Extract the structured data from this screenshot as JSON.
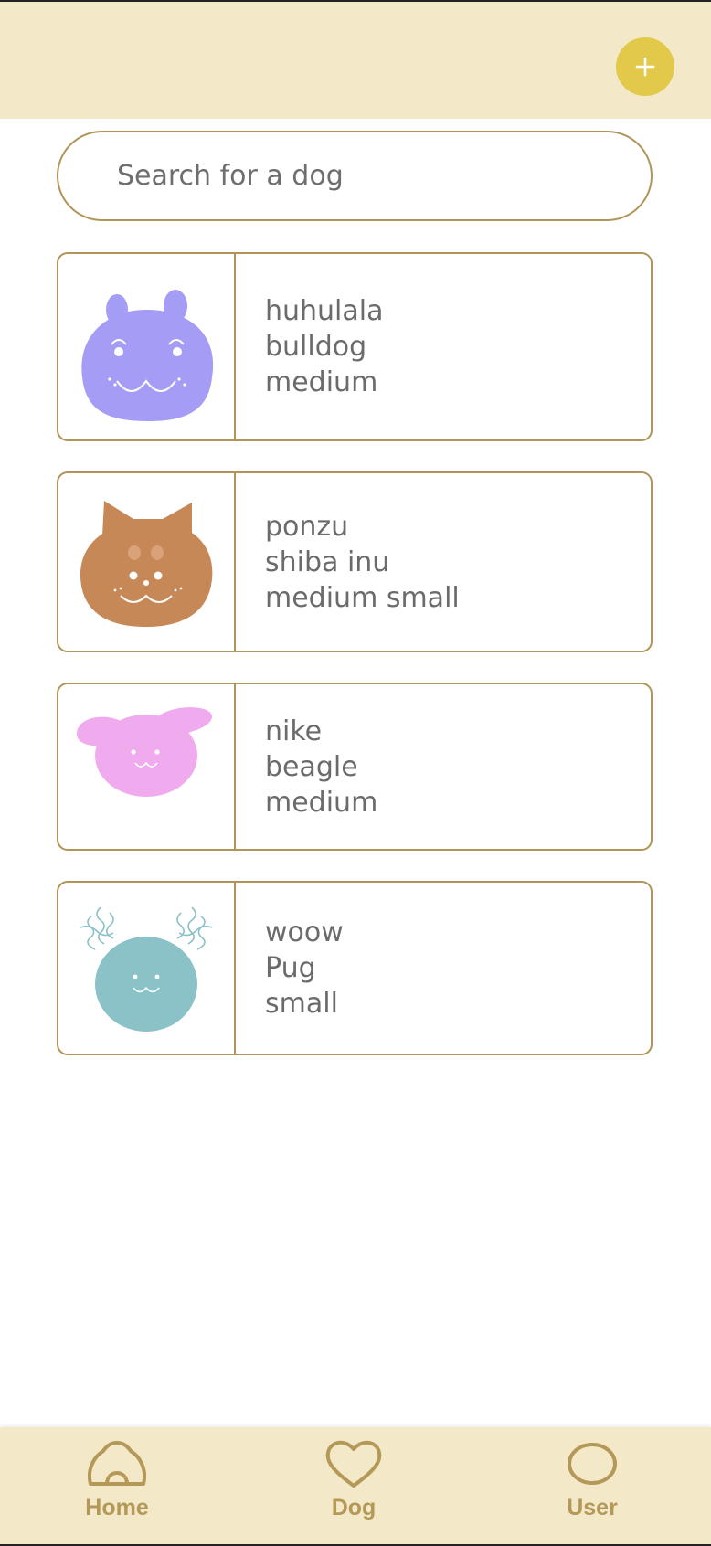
{
  "header": {
    "add_icon": "plus-icon"
  },
  "search": {
    "placeholder": "Search for a dog"
  },
  "dogs": [
    {
      "name": "huhulala",
      "breed": "bulldog",
      "size": "medium",
      "avatar_color": "#a59cf6"
    },
    {
      "name": "ponzu",
      "breed": "shiba inu",
      "size": "medium small",
      "avatar_color": "#c68857"
    },
    {
      "name": "nike",
      "breed": "beagle",
      "size": "medium",
      "avatar_color": "#f0aaee"
    },
    {
      "name": "woow",
      "breed": "Pug",
      "size": "small",
      "avatar_color": "#8ac2c8"
    }
  ],
  "tabbar": {
    "items": [
      {
        "label": "Home",
        "icon": "home-icon"
      },
      {
        "label": "Dog",
        "icon": "heart-icon"
      },
      {
        "label": "User",
        "icon": "user-icon"
      }
    ]
  },
  "colors": {
    "accent": "#e2c94a",
    "bar_bg": "#f3e8c8",
    "border": "#b09458",
    "nav_text": "#b39857"
  }
}
